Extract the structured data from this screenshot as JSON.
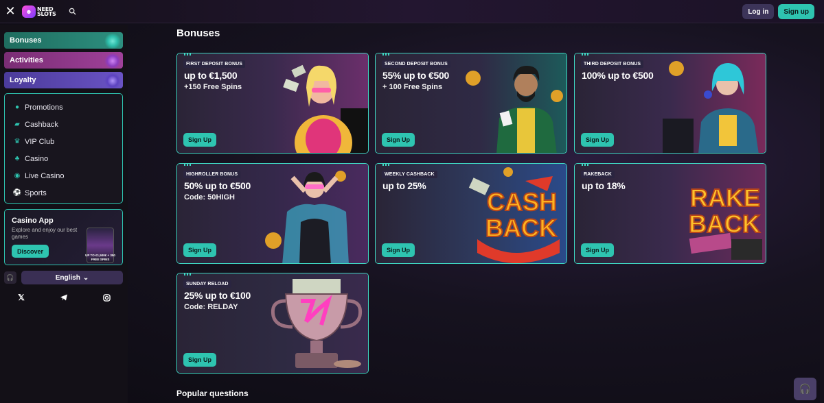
{
  "header": {
    "close_icon": "close-icon",
    "logo_text_line1": "NEED",
    "logo_text_line2": "SLOTS",
    "search_icon": "search-icon",
    "login_label": "Log in",
    "signup_label": "Sign up"
  },
  "sidebar": {
    "main_items": [
      {
        "label": "Bonuses"
      },
      {
        "label": "Activities"
      },
      {
        "label": "Loyalty"
      }
    ],
    "sub_items": [
      {
        "label": "Promotions",
        "icon": "percent-icon"
      },
      {
        "label": "Cashback",
        "icon": "wallet-icon"
      },
      {
        "label": "VIP Club",
        "icon": "crown-icon"
      },
      {
        "label": "Casino",
        "icon": "cherries-icon"
      },
      {
        "label": "Live Casino",
        "icon": "live-icon"
      },
      {
        "label": "Sports",
        "icon": "ball-icon"
      }
    ],
    "app_card": {
      "title": "Casino App",
      "description": "Explore and enjoy our best games",
      "button": "Discover",
      "promo_text": "UP TO €1,500€ + 350 FREE SPINS"
    },
    "language": "English",
    "socials": [
      "X",
      "Telegram",
      "Instagram"
    ]
  },
  "main": {
    "title": "Bonuses",
    "cards": [
      {
        "tag": "FIRST DEPOSIT BONUS",
        "title": "up to €1,500",
        "sub": "+150 Free Spins",
        "button": "Sign Up"
      },
      {
        "tag": "SECOND DEPOSIT BONUS",
        "title": "55% up to €500",
        "sub": "+ 100 Free Spins",
        "button": "Sign Up"
      },
      {
        "tag": "THIRD DEPOSIT BONUS",
        "title": "100% up to €500",
        "sub": "",
        "button": "Sign Up"
      },
      {
        "tag": "HIGHROLLER BONUS",
        "title": "50% up to €500",
        "sub": "Code: 50HIGH",
        "button": "Sign Up"
      },
      {
        "tag": "WEEKLY CASHBACK",
        "title": "up to 25%",
        "sub": "",
        "button": "Sign Up",
        "art_text_1": "CASH",
        "art_text_2": "BACK"
      },
      {
        "tag": "RAKEBACK",
        "title": "up to 18%",
        "sub": "",
        "button": "Sign Up",
        "art_text_1": "RAKE",
        "art_text_2": "BACK"
      },
      {
        "tag": "SUNDAY RELOAD",
        "title": "25% up to €100",
        "sub": "Code: RELDAY",
        "button": "Sign Up"
      }
    ],
    "popular_questions": "Popular questions"
  },
  "colors": {
    "accent": "#2ec4b0",
    "card_border": "#3fd9c4",
    "bonuses_nav": "#2d8f7f",
    "activities_nav": "#a0419a",
    "loyalty_nav": "#6a53c4"
  }
}
